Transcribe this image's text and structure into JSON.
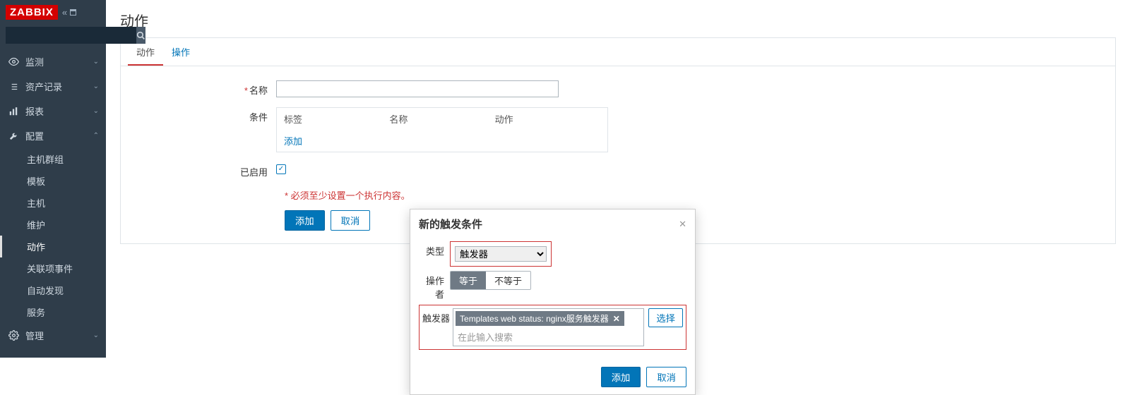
{
  "logo": "ZABBIX",
  "nav": {
    "monitoring": {
      "label": "监测"
    },
    "inventory": {
      "label": "资产记录"
    },
    "reports": {
      "label": "报表"
    },
    "config": {
      "label": "配置",
      "items": {
        "hostgroups": "主机群组",
        "templates": "模板",
        "hosts": "主机",
        "maintenance": "维护",
        "actions": "动作",
        "eventcorr": "关联项事件",
        "discovery": "自动发现",
        "services": "服务"
      }
    },
    "admin": {
      "label": "管理"
    }
  },
  "page": {
    "title": "动作"
  },
  "tabs": {
    "action": "动作",
    "operation": "操作"
  },
  "form": {
    "name_label": "名称",
    "cond_label": "条件",
    "cond_headers": {
      "tag": "标签",
      "name": "名称",
      "action": "动作"
    },
    "cond_add": "添加",
    "enabled_label": "已启用",
    "warning": "必须至少设置一个执行内容。",
    "add": "添加",
    "cancel": "取消"
  },
  "modal": {
    "title": "新的触发条件",
    "type_label": "类型",
    "type_value": "触发器",
    "op_label": "操作者",
    "op_eq": "等于",
    "op_neq": "不等于",
    "trig_label": "触发器",
    "trigger_tag": "Templates web status: nginx服务触发器",
    "trig_placeholder": "在此输入搜索",
    "select": "选择",
    "add": "添加",
    "cancel": "取消"
  }
}
